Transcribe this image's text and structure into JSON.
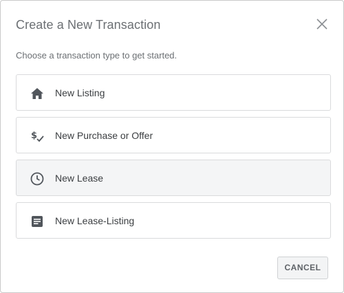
{
  "dialog": {
    "title": "Create a New Transaction",
    "subtitle": "Choose a transaction type to get started.",
    "close_icon": "close-icon",
    "options": [
      {
        "label": "New Listing",
        "icon": "home-icon"
      },
      {
        "label": "New Purchase or Offer",
        "icon": "dollar-check-icon"
      },
      {
        "label": "New Lease",
        "icon": "clock-icon"
      },
      {
        "label": "New Lease-Listing",
        "icon": "document-icon"
      }
    ],
    "cancel_label": "CANCEL"
  },
  "colors": {
    "icon": "#51565c",
    "text": "#3a3d40",
    "muted_text": "#6b6f73",
    "border": "#d9dadc",
    "hover_bg": "#f4f5f6"
  }
}
